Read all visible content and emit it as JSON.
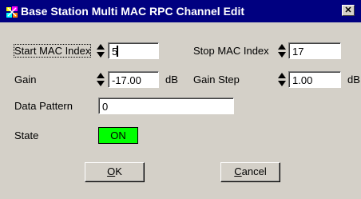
{
  "window": {
    "title": "Base Station Multi MAC RPC Channel Edit",
    "close_glyph": "✕",
    "app_icon": "app-icon",
    "titlebar_color": "#000080"
  },
  "fields": {
    "start_mac_index": {
      "label": "Start MAC Index",
      "value": "5"
    },
    "stop_mac_index": {
      "label": "Stop MAC Index",
      "value": "17"
    },
    "gain": {
      "label": "Gain",
      "value": "-17.00",
      "unit": "dB"
    },
    "gain_step": {
      "label": "Gain Step",
      "value": "1.00",
      "unit": "dB"
    },
    "data_pattern": {
      "label": "Data Pattern",
      "value": "0"
    },
    "state": {
      "label": "State",
      "value": "ON",
      "color": "#00ff00"
    }
  },
  "buttons": {
    "ok": {
      "mnemonic": "O",
      "rest": "K"
    },
    "cancel": {
      "mnemonic": "C",
      "rest": "ancel"
    }
  }
}
